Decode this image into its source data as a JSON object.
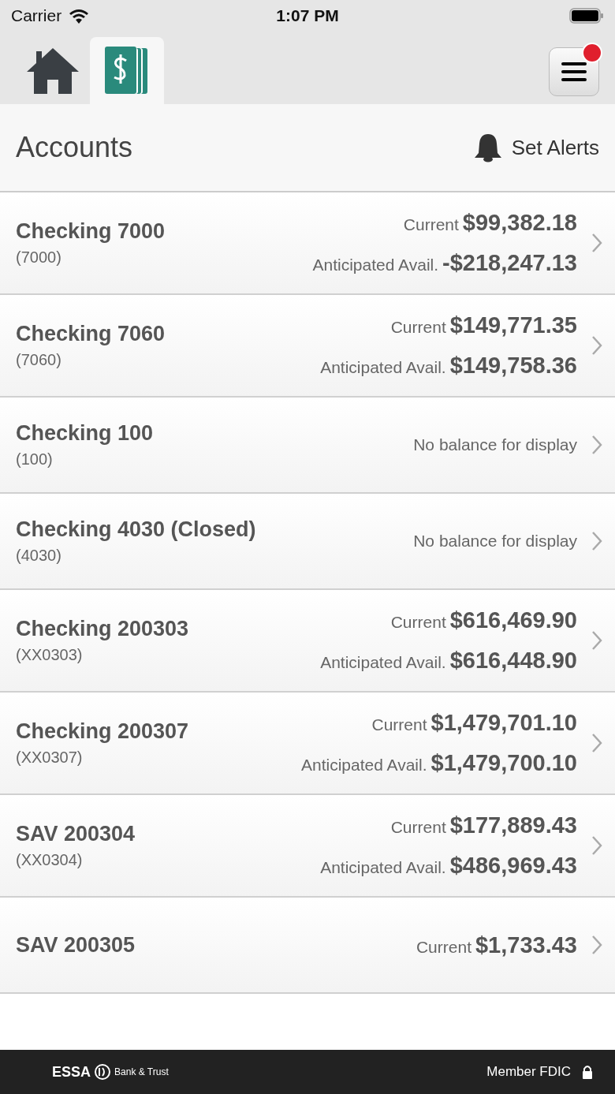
{
  "status_bar": {
    "carrier": "Carrier",
    "time": "1:07 PM"
  },
  "tabs": [
    {
      "kind": "home",
      "selected": false
    },
    {
      "kind": "accounts",
      "selected": true
    }
  ],
  "menu_button": {
    "has_notification": true
  },
  "header": {
    "title": "Accounts",
    "alerts_label": "Set Alerts"
  },
  "accounts": [
    {
      "name": "Checking 7000",
      "number": "(7000)",
      "kind": "balances",
      "balances": [
        {
          "label": "Current",
          "value": "$99,382.18"
        },
        {
          "label": "Anticipated Avail.",
          "value": "-$218,247.13"
        }
      ]
    },
    {
      "name": "Checking 7060",
      "number": "(7060)",
      "kind": "balances",
      "balances": [
        {
          "label": "Current",
          "value": "$149,771.35"
        },
        {
          "label": "Anticipated Avail.",
          "value": "$149,758.36"
        }
      ]
    },
    {
      "name": "Checking 100",
      "number": "(100)",
      "kind": "message",
      "message": "No balance for display"
    },
    {
      "name": "Checking 4030 (Closed)",
      "number": "(4030)",
      "kind": "message",
      "message": "No balance for display"
    },
    {
      "name": "Checking 200303",
      "number": "(XX0303)",
      "kind": "balances",
      "balances": [
        {
          "label": "Current",
          "value": "$616,469.90"
        },
        {
          "label": "Anticipated Avail.",
          "value": "$616,448.90"
        }
      ]
    },
    {
      "name": "Checking 200307",
      "number": "(XX0307)",
      "kind": "balances",
      "balances": [
        {
          "label": "Current",
          "value": "$1,479,701.10"
        },
        {
          "label": "Anticipated Avail.",
          "value": "$1,479,700.10"
        }
      ]
    },
    {
      "name": "SAV 200304",
      "number": "(XX0304)",
      "kind": "balances",
      "balances": [
        {
          "label": "Current",
          "value": "$177,889.43"
        },
        {
          "label": "Anticipated Avail.",
          "value": "$486,969.43"
        }
      ]
    },
    {
      "name": "SAV 200305",
      "kind": "balances",
      "balances": [
        {
          "label": "Current",
          "value": "$1,733.43"
        }
      ]
    }
  ],
  "footer": {
    "brand": "ESSA",
    "brand_sub": "Bank & Trust",
    "member": "Member FDIC"
  }
}
